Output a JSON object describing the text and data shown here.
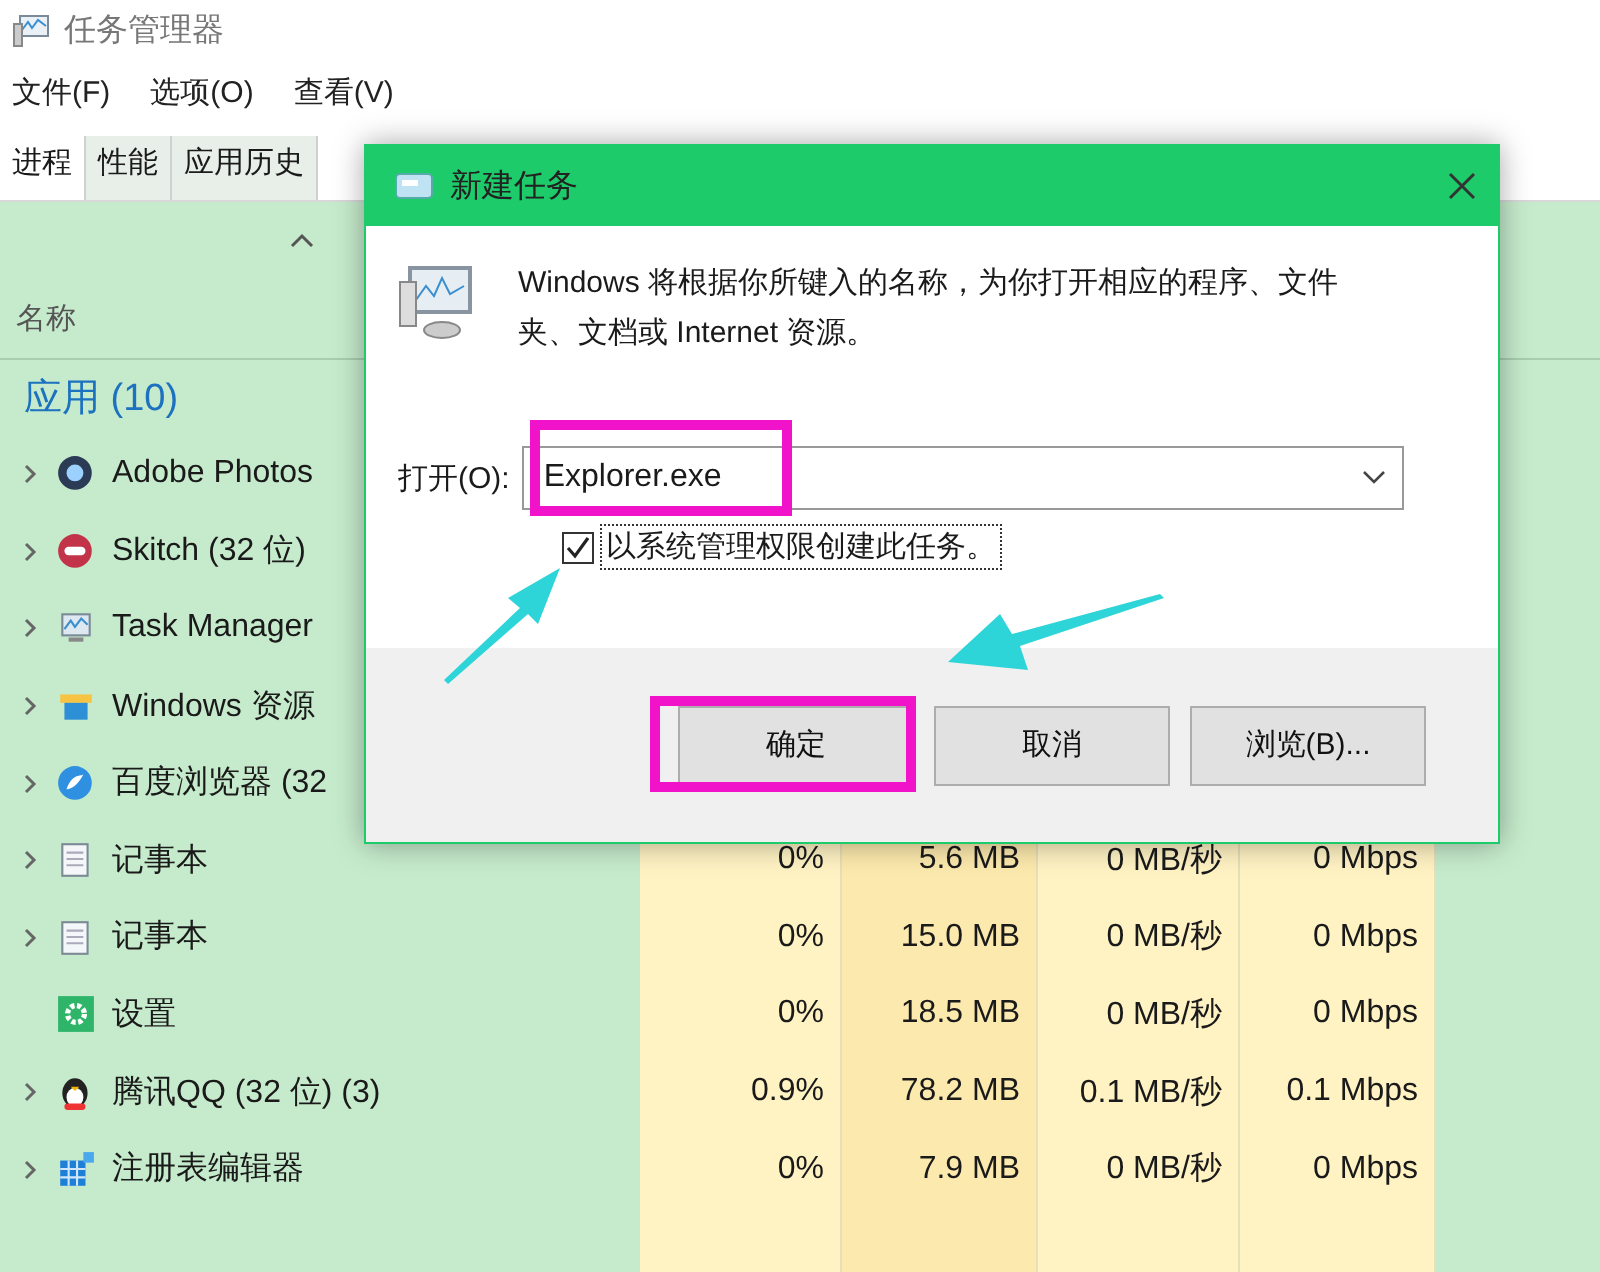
{
  "window": {
    "title": "任务管理器"
  },
  "menu": [
    "文件(F)",
    "选项(O)",
    "查看(V)"
  ],
  "tabs": [
    {
      "label": "进程",
      "selected": true
    },
    {
      "label": "性能",
      "selected": false
    },
    {
      "label": "应用历史",
      "selected": false
    }
  ],
  "table": {
    "name_header": "名称",
    "group": "应用 (10)",
    "rows": [
      {
        "name": "Adobe Photos",
        "expandable": true
      },
      {
        "name": "Skitch (32 位)",
        "expandable": true
      },
      {
        "name": "Task Manager",
        "expandable": true
      },
      {
        "name": "Windows 资源",
        "expandable": true
      },
      {
        "name": "百度浏览器 (32",
        "expandable": true
      },
      {
        "name": "记事本",
        "expandable": true,
        "cpu": "0%",
        "memory": "5.6 MB",
        "disk": "0 MB/秒",
        "network": "0 Mbps"
      },
      {
        "name": "记事本",
        "expandable": true,
        "cpu": "0%",
        "memory": "15.0 MB",
        "disk": "0 MB/秒",
        "network": "0 Mbps"
      },
      {
        "name": "设置",
        "expandable": false,
        "cpu": "0%",
        "memory": "18.5 MB",
        "disk": "0 MB/秒",
        "network": "0 Mbps"
      },
      {
        "name": "腾讯QQ (32 位) (3)",
        "expandable": true,
        "cpu": "0.9%",
        "memory": "78.2 MB",
        "disk": "0.1 MB/秒",
        "network": "0.1 Mbps"
      },
      {
        "name": "注册表编辑器",
        "expandable": true,
        "cpu": "0%",
        "memory": "7.9 MB",
        "disk": "0 MB/秒",
        "network": "0 Mbps"
      }
    ]
  },
  "dialog": {
    "title": "新建任务",
    "message": "Windows 将根据你所键入的名称，为你打开相应的程序、文件夹、文档或 Internet 资源。",
    "open_label": "打开(O):",
    "open_value": "Explorer.exe",
    "admin_checkbox": {
      "label": "以系统管理权限创建此任务。",
      "checked": true
    },
    "buttons": [
      "确定",
      "取消",
      "浏览(B)..."
    ]
  }
}
